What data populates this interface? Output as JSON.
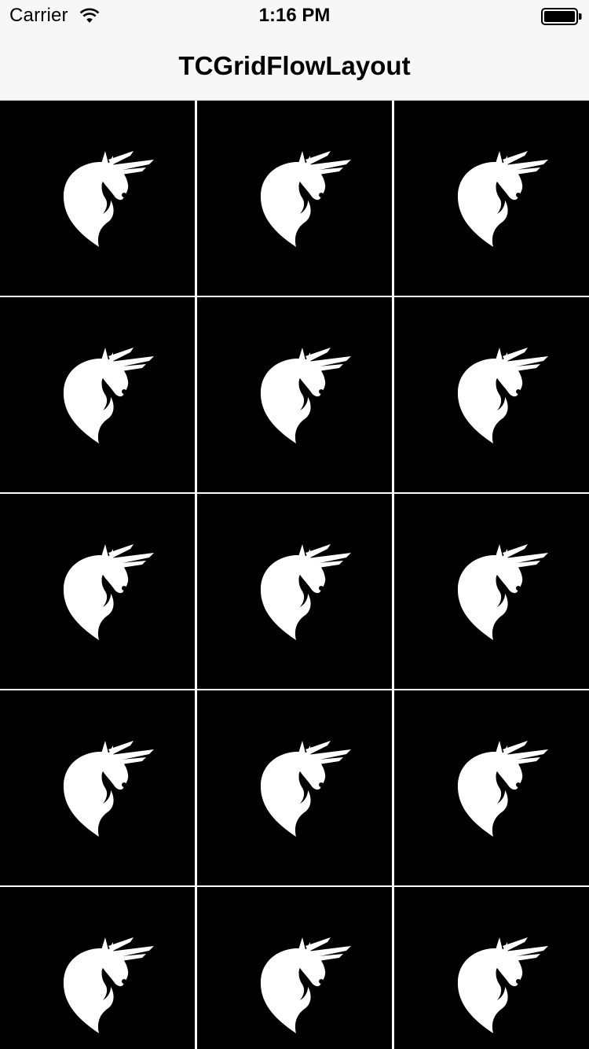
{
  "status_bar": {
    "carrier": "Carrier",
    "time": "1:16 PM",
    "wifi_icon": "wifi-icon",
    "battery_icon": "battery-icon"
  },
  "nav_bar": {
    "title": "TCGridFlowLayout"
  },
  "grid": {
    "columns": 3,
    "cell_color": "#000000",
    "icon": "unicorn-icon",
    "icon_color": "#ffffff",
    "cell_count": 15
  }
}
